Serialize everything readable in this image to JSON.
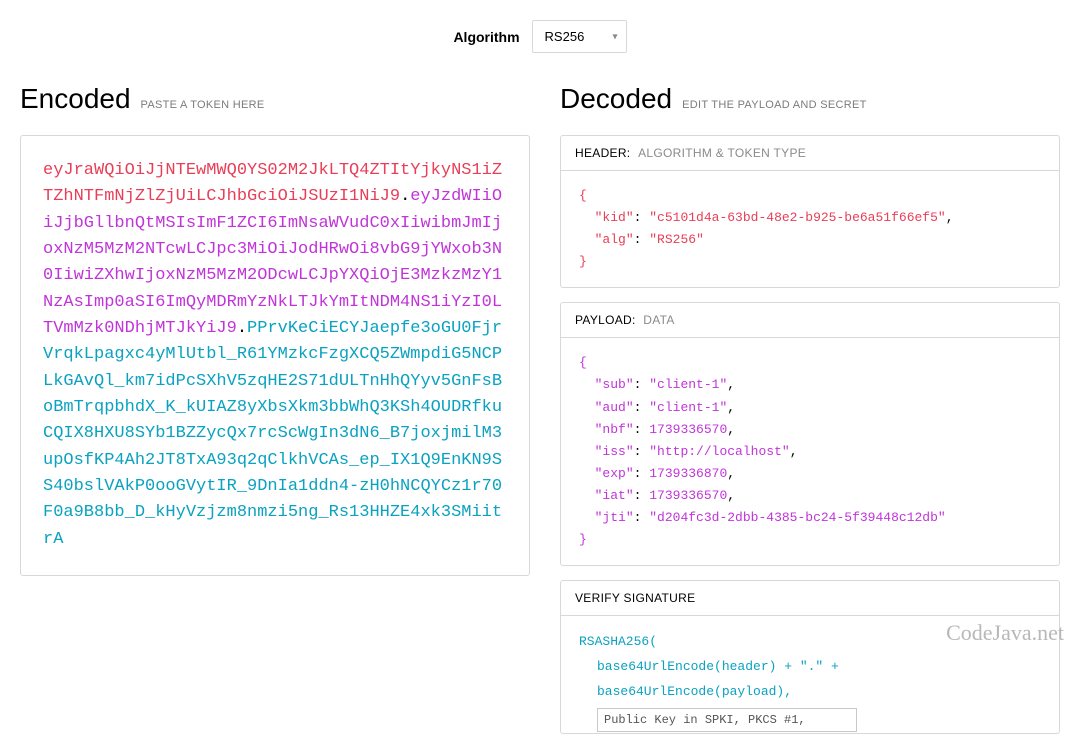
{
  "algorithm": {
    "label": "Algorithm",
    "value": "RS256"
  },
  "encoded": {
    "title": "Encoded",
    "subtitle": "PASTE A TOKEN HERE",
    "header": "eyJraWQiOiJjNTEwMWQ0YS02M2JkLTQ4ZTItYjkyNS1iZTZhNTFmNjZlZjUiLCJhbGciOiJSUzI1NiJ9",
    "payload": "eyJzdWIiOiJjbGllbnQtMSIsImF1ZCI6ImNsaWVudC0xIiwibmJmIjoxNzM5MzM2NTcwLCJpc3MiOiJodHRwOi8vbG9jYWxob3N0IiwiZXhwIjoxNzM5MzM2ODcwLCJpYXQiOjE3MzkzMzY1NzAsImp0aSI6ImQyMDRmYzNkLTJkYmItNDM4NS1iYzI0LTVmMzk0NDhjMTJkYiJ9",
    "signature": "PPrvKeCiECYJaepfe3oGU0FjrVrqkLpagxc4yMlUtbl_R61YMzkcFzgXCQ5ZWmpdiG5NCPLkGAvQl_km7idPcSXhV5zqHE2S71dULTnHhQYyv5GnFsBoBmTrqpbhdX_K_kUIAZ8yXbsXkm3bbWhQ3KSh4OUDRfkuCQIX8HXU8SYb1BZZycQx7rcScWgIn3dN6_B7joxjmilM3upOsfKP4Ah2JT8TxA93q2qClkhVCAs_ep_IX1Q9EnKN9SS40bslVAkP0ooGVytIR_9DnIa1ddn4-zH0hNCQYCz1r70F0a9B8bb_D_kHyVzjzm8nmzi5ng_Rs13HHZE4xk3SMiitrA"
  },
  "decoded": {
    "title": "Decoded",
    "subtitle": "EDIT THE PAYLOAD AND SECRET",
    "header_panel": {
      "title_a": "HEADER:",
      "title_b": "ALGORITHM & TOKEN TYPE",
      "kid": "c5101d4a-63bd-48e2-b925-be6a51f66ef5",
      "alg": "RS256"
    },
    "payload_panel": {
      "title_a": "PAYLOAD:",
      "title_b": "DATA",
      "sub": "client-1",
      "aud": "client-1",
      "nbf": 1739336570,
      "iss": "http://localhost",
      "exp": 1739336870,
      "iat": 1739336570,
      "jti": "d204fc3d-2dbb-4385-bc24-5f39448c12db"
    },
    "signature_panel": {
      "title": "VERIFY SIGNATURE",
      "line1": "RSASHA256(",
      "line2": "base64UrlEncode(header) + \".\" +",
      "line3": "base64UrlEncode(payload),",
      "key_placeholder": "Public Key in SPKI, PKCS #1,"
    }
  },
  "watermark": "CodeJava.net"
}
